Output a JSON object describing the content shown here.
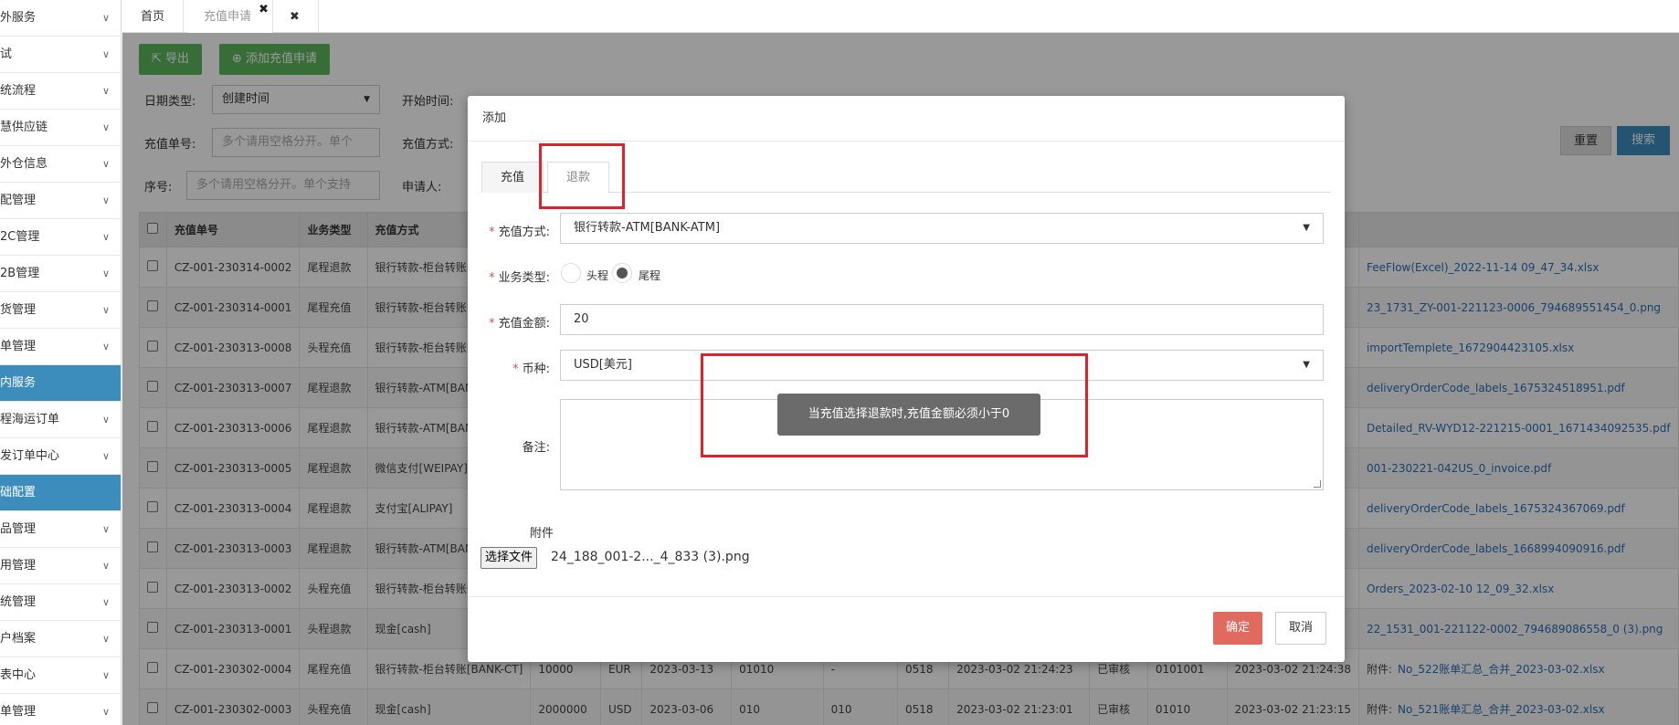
{
  "sidebar": {
    "items": [
      {
        "label": "外服务",
        "active": false
      },
      {
        "label": "试",
        "active": false
      },
      {
        "label": "统流程",
        "active": false
      },
      {
        "label": "慧供应链",
        "active": false
      },
      {
        "label": "外仓信息",
        "active": false
      },
      {
        "label": "配管理",
        "active": false
      },
      {
        "label": "2C管理",
        "active": false
      },
      {
        "label": "2B管理",
        "active": false
      },
      {
        "label": "货管理",
        "active": false
      },
      {
        "label": "单管理",
        "active": false
      },
      {
        "label": "内服务",
        "active": true
      },
      {
        "label": "程海运订单",
        "active": false
      },
      {
        "label": "发订单中心",
        "active": false
      },
      {
        "label": "础配置",
        "active": true
      },
      {
        "label": "品管理",
        "active": false
      },
      {
        "label": "用管理",
        "active": false
      },
      {
        "label": "统管理",
        "active": false
      },
      {
        "label": "户档案",
        "active": false
      },
      {
        "label": "表中心",
        "active": false
      },
      {
        "label": "单管理",
        "active": false
      }
    ]
  },
  "tabs": {
    "home": "首页",
    "current": "充值申请",
    "close_all": "✖"
  },
  "toolbar": {
    "export": "导出",
    "add": "添加充值申请"
  },
  "filters": {
    "date_type_label": "日期类型:",
    "date_type_value": "创建时间",
    "start_time_label": "开始时间:",
    "order_no_label": "充值单号:",
    "order_no_placeholder": "多个请用空格分开。单个",
    "method_label": "充值方式:",
    "seq_label": "序号:",
    "seq_placeholder": "多个请用空格分开。单个支持",
    "applicant_label": "申请人:",
    "reset": "重置",
    "search": "搜索"
  },
  "table": {
    "headers": [
      "充值单号",
      "业务类型",
      "充值方式"
    ],
    "rows": [
      {
        "no": "CZ-001-230314-0002",
        "type": "尾程退款",
        "method": "银行转款-柜台转账[B",
        "attach": "FeeFlow(Excel)_2022-11-14 09_47_34.xlsx"
      },
      {
        "no": "CZ-001-230314-0001",
        "type": "尾程充值",
        "method": "银行转款-柜台转账[B",
        "attach": "23_1731_ZY-001-221123-0006_794689551454_0.png"
      },
      {
        "no": "CZ-001-230313-0008",
        "type": "头程充值",
        "method": "银行转款-柜台转账[B",
        "attach": "importTemplete_1672904423105.xlsx"
      },
      {
        "no": "CZ-001-230313-0007",
        "type": "尾程退款",
        "method": "银行转款-ATM[BAN",
        "attach": "deliveryOrderCode_labels_1675324518951.pdf"
      },
      {
        "no": "CZ-001-230313-0006",
        "type": "尾程退款",
        "method": "银行转款-ATM[BAN",
        "attach": "Detailed_RV-WYD12-221215-0001_1671434092535.pdf"
      },
      {
        "no": "CZ-001-230313-0005",
        "type": "尾程退款",
        "method": "微信支付[WEIPAY]",
        "attach": "001-230221-042US_0_invoice.pdf"
      },
      {
        "no": "CZ-001-230313-0004",
        "type": "尾程退款",
        "method": "支付宝[ALIPAY]",
        "attach": "deliveryOrderCode_labels_1675324367069.pdf"
      },
      {
        "no": "CZ-001-230313-0003",
        "type": "尾程退款",
        "method": "银行转款-ATM[BAN",
        "attach": "deliveryOrderCode_labels_1668994090916.pdf"
      },
      {
        "no": "CZ-001-230313-0002",
        "type": "头程充值",
        "method": "银行转款-柜台转账[B",
        "attach": "Orders_2023-02-10 12_09_32.xlsx"
      },
      {
        "no": "CZ-001-230313-0001",
        "type": "头程退款",
        "method": "现金[cash]",
        "attach": "22_1531_001-221122-0002_794689086558_0 (3).png"
      },
      {
        "no": "CZ-001-230302-0004",
        "type": "尾程充值",
        "method": "银行转款-柜台转账[BANK-CT]",
        "amount": "10000",
        "currency": "EUR",
        "date": "2023-03-13",
        "code1": "01010",
        "code2": "-",
        "code3": "0518",
        "created": "2023-03-02 21:24:23",
        "status": "已审核",
        "reviewer": "0101001",
        "reviewed": "2023-03-02 21:24:38",
        "attach_label": "附件:",
        "attach": "No_522账单汇总_合并_2023-03-02.xlsx"
      },
      {
        "no": "CZ-001-230302-0003",
        "type": "头程充值",
        "method": "现金[cash]",
        "amount": "2000000",
        "currency": "USD",
        "date": "2023-03-06",
        "code1": "010",
        "code2": "010",
        "code3": "0518",
        "created": "2023-03-02 21:23:01",
        "status": "已审核",
        "reviewer": "01010",
        "reviewed": "2023-03-02 21:23:15",
        "attach_label": "附件:",
        "attach": "No_521账单汇总_合并_2023-03-02.xlsx"
      }
    ]
  },
  "modal": {
    "title": "添加",
    "tab_recharge": "充值",
    "tab_refund": "退款",
    "method_label": "充值方式:",
    "method_value": "银行转款-ATM[BANK-ATM]",
    "biz_type_label": "业务类型:",
    "biz_opt1": "头程",
    "biz_opt2": "尾程",
    "amount_label": "充值金额:",
    "amount_value": "20",
    "currency_label": "币种:",
    "currency_value": "USD[美元]",
    "remark_label": "备注:",
    "attach_label": "附件",
    "file_button": "选择文件",
    "file_name": "24_188_001-2..._4_833 (3).png",
    "ok": "确定",
    "cancel": "取消",
    "toast": "当充值选择退款时,充值金额必须小于0",
    "required_mark": "*"
  }
}
